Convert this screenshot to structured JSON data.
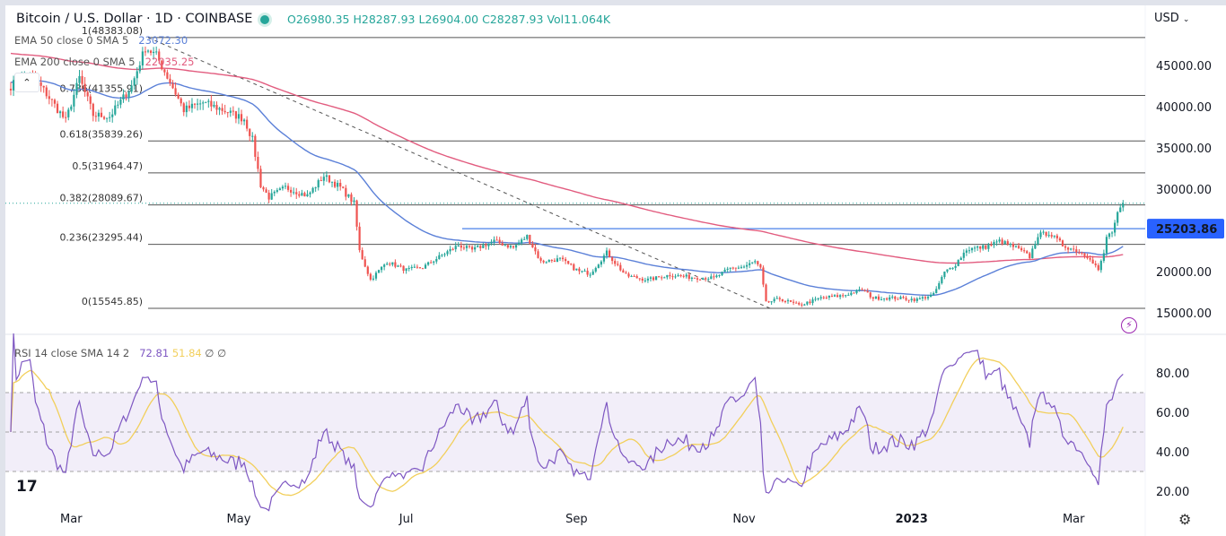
{
  "header": {
    "symbol": "Bitcoin / U.S. Dollar · 1D · COINBASE",
    "open": "O26980.35",
    "high": "H28287.93",
    "low": "L26904.00",
    "close": "C28287.93",
    "volume": "Vol11.064K",
    "currency": "USD"
  },
  "indicators": {
    "ema50_label": "EMA 50 close 0 SMA 5",
    "ema50_value": "23072.30",
    "ema200_label": "EMA 200 close 0 SMA 5",
    "ema200_value": "22035.25",
    "rsi_label": "RSI 14 close SMA 14 2",
    "rsi_value": "72.81",
    "rsi_ma_value": "51.84",
    "rsi_extra": "∅ ∅"
  },
  "colors": {
    "up": "#26a69a",
    "down": "#ef5350",
    "ema50": "#5b80d8",
    "ema200": "#e25c7f",
    "rsi": "#7e57c2",
    "rsi_ma": "#f2cf5b",
    "hline": "#2962ff"
  },
  "chart_data": {
    "type": "candlestick",
    "title": "Bitcoin / U.S. Dollar · 1D · COINBASE",
    "price_axis": {
      "ticks": [
        "45000.00",
        "40000.00",
        "35000.00",
        "30000.00",
        "20000.00",
        "15000.00"
      ],
      "tick_values": [
        45000,
        40000,
        35000,
        30000,
        20000,
        15000
      ],
      "range": [
        13000,
        50000
      ]
    },
    "rsi_axis": {
      "ticks": [
        "80.00",
        "60.00",
        "40.00",
        "20.00"
      ],
      "tick_values": [
        80,
        60,
        40,
        20
      ],
      "band": [
        30,
        70
      ],
      "mid": 50
    },
    "time_axis": [
      {
        "label": "Mar",
        "day": 22
      },
      {
        "label": "May",
        "day": 83
      },
      {
        "label": "Jul",
        "day": 144
      },
      {
        "label": "Sep",
        "day": 206
      },
      {
        "label": "Nov",
        "day": 267
      },
      {
        "label": "2023",
        "day": 328
      },
      {
        "label": "Mar",
        "day": 387
      }
    ],
    "close_anchors": [
      [
        0,
        42500
      ],
      [
        6,
        44200
      ],
      [
        12,
        42000
      ],
      [
        20,
        38300
      ],
      [
        25,
        43500
      ],
      [
        30,
        39000
      ],
      [
        36,
        38800
      ],
      [
        44,
        42500
      ],
      [
        49,
        47200
      ],
      [
        53,
        46200
      ],
      [
        58,
        43000
      ],
      [
        63,
        39600
      ],
      [
        70,
        40500
      ],
      [
        78,
        39500
      ],
      [
        85,
        38500
      ],
      [
        88,
        36000
      ],
      [
        91,
        30500
      ],
      [
        94,
        29000
      ],
      [
        100,
        30200
      ],
      [
        108,
        29200
      ],
      [
        114,
        31600
      ],
      [
        120,
        30200
      ],
      [
        125,
        28300
      ],
      [
        127,
        22500
      ],
      [
        131,
        19000
      ],
      [
        137,
        21200
      ],
      [
        144,
        20200
      ],
      [
        150,
        20500
      ],
      [
        157,
        22000
      ],
      [
        163,
        23200
      ],
      [
        168,
        22600
      ],
      [
        176,
        23700
      ],
      [
        183,
        22900
      ],
      [
        188,
        24300
      ],
      [
        193,
        21200
      ],
      [
        200,
        21500
      ],
      [
        207,
        20000
      ],
      [
        211,
        19800
      ],
      [
        217,
        22300
      ],
      [
        224,
        19500
      ],
      [
        232,
        19000
      ],
      [
        240,
        19600
      ],
      [
        248,
        19300
      ],
      [
        256,
        19200
      ],
      [
        262,
        20400
      ],
      [
        267,
        20600
      ],
      [
        271,
        21200
      ],
      [
        273,
        20300
      ],
      [
        275,
        16200
      ],
      [
        280,
        16700
      ],
      [
        287,
        15900
      ],
      [
        295,
        16800
      ],
      [
        303,
        17100
      ],
      [
        310,
        17800
      ],
      [
        314,
        16800
      ],
      [
        322,
        16800
      ],
      [
        330,
        16600
      ],
      [
        336,
        17200
      ],
      [
        340,
        19900
      ],
      [
        344,
        20900
      ],
      [
        348,
        22700
      ],
      [
        355,
        23000
      ],
      [
        360,
        23700
      ],
      [
        366,
        22900
      ],
      [
        371,
        21800
      ],
      [
        374,
        24400
      ],
      [
        378,
        24700
      ],
      [
        383,
        23200
      ],
      [
        389,
        22400
      ],
      [
        393,
        21700
      ],
      [
        396,
        20200
      ],
      [
        398,
        22100
      ],
      [
        399,
        24200
      ],
      [
        401,
        24800
      ],
      [
        403,
        26900
      ],
      [
        405,
        28287.93
      ]
    ],
    "last_candle": {
      "open": 26980.35,
      "high": 28287.93,
      "low": 26904.0,
      "close": 28287.93
    },
    "ema50_last": 23072.3,
    "ema200_last": 22035.25,
    "rsi_last": 72.81,
    "rsi_ma_last": 51.84,
    "fibonacci": [
      {
        "label": "1(48383.08)",
        "value": 48383.08
      },
      {
        "label": "0.786(41355.91)",
        "value": 41355.91
      },
      {
        "label": "0.618(35839.26)",
        "value": 35839.26
      },
      {
        "label": "0.5(31964.47)",
        "value": 31964.47
      },
      {
        "label": "0.382(28089.67)",
        "value": 28089.67
      },
      {
        "label": "0.236(23295.44)",
        "value": 23295.44
      },
      {
        "label": "0(15545.85)",
        "value": 15545.85
      }
    ],
    "horizontal_line": {
      "label": "25203.86",
      "value": 25203.86
    },
    "current_price": 28287.93
  }
}
